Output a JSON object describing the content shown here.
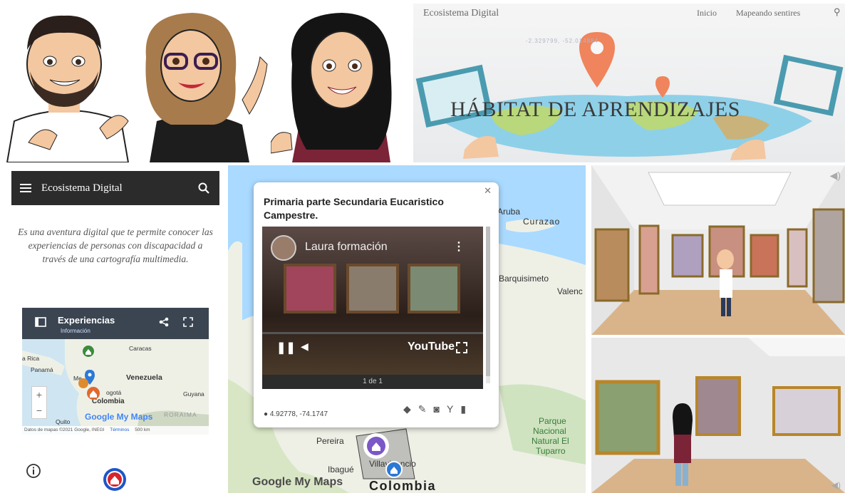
{
  "banner": {
    "brand": "Ecosistema Digital",
    "nav": [
      "Inicio",
      "Mapeando sentires"
    ],
    "coords": "-2.329799, -52.014884",
    "title": "HÁBITAT DE APRENDIZAJES"
  },
  "phone": {
    "app_title": "Ecosistema Digital",
    "description": "Es una aventura digital que te permite conocer las experiencias de personas con discapacidad a través de una cartografía multimedia.",
    "mymaps": {
      "title": "Experiencias",
      "subtitle": "Información",
      "labels": {
        "caracas": "Caracas",
        "rica": "a Rica",
        "panama": "Panamá",
        "venezuela": "Venezuela",
        "bogota": "ogotá",
        "colombia": "Colombia",
        "guyana": "Guyana",
        "quito": "Quito",
        "roraima": "RORAIMA",
        "medellin": "Me"
      },
      "brand": "Google My Maps",
      "attribution": "Datos de mapas ©2021 Google, INEGI",
      "terms": "Términos",
      "scale": "500 km"
    }
  },
  "map": {
    "labels": {
      "aruba": "Aruba",
      "curazao": "Curazao",
      "barquisimeto": "Barquisimeto",
      "valencia": "Valenc",
      "parque1": "Parque",
      "parque2": "Nacional",
      "parque3": "Natural El",
      "parque4": "Tuparro",
      "pereira": "Pereira",
      "ibague": "Ibagué",
      "villavicencio": "Villavicencio",
      "colombia": "Colombia",
      "google": "Google My Maps"
    },
    "popup": {
      "title": "Primaria parte Secundaria Eucaristico Campestre.",
      "channel": "Laura formación",
      "youtube": "YouTube",
      "pager": "1 de 1",
      "coords": "4.92778, -74.1747"
    }
  },
  "colors": {
    "dark_bar": "#2b2b2b",
    "mymaps_header": "#3b4552",
    "map_water": "#aadaff",
    "land": "#eef0e6",
    "pin_purple": "#7b57c7",
    "pin_blue": "#2b79d6"
  }
}
